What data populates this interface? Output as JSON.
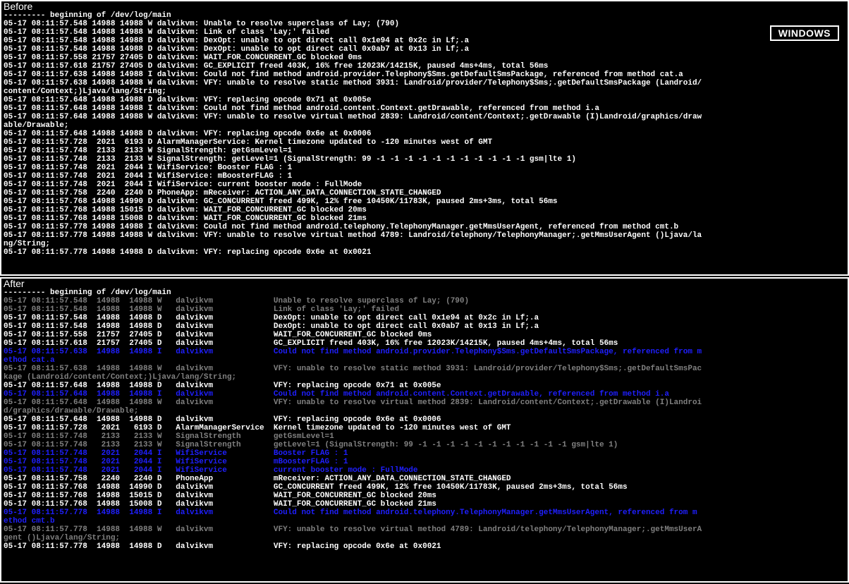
{
  "badge": "WINDOWS",
  "before": {
    "title": "Before",
    "lines": [
      "--------- beginning of /dev/log/main",
      "05-17 08:11:57.548 14988 14988 W dalvikvm: Unable to resolve superclass of Lay; (790)",
      "05-17 08:11:57.548 14988 14988 W dalvikvm: Link of class 'Lay;' failed",
      "05-17 08:11:57.548 14988 14988 D dalvikvm: DexOpt: unable to opt direct call 0x1e94 at 0x2c in Lf;.a",
      "05-17 08:11:57.548 14988 14988 D dalvikvm: DexOpt: unable to opt direct call 0x0ab7 at 0x13 in Lf;.a",
      "05-17 08:11:57.558 21757 27405 D dalvikvm: WAIT_FOR_CONCURRENT_GC blocked 0ms",
      "05-17 08:11:57.618 21757 27405 D dalvikvm: GC_EXPLICIT freed 403K, 16% free 12023K/14215K, paused 4ms+4ms, total 56ms",
      "05-17 08:11:57.638 14988 14988 I dalvikvm: Could not find method android.provider.Telephony$Sms.getDefaultSmsPackage, referenced from method cat.a",
      "05-17 08:11:57.638 14988 14988 W dalvikvm: VFY: unable to resolve static method 3931: Landroid/provider/Telephony$Sms;.getDefaultSmsPackage (Landroid/",
      "content/Context;)Ljava/lang/String;",
      "05-17 08:11:57.648 14988 14988 D dalvikvm: VFY: replacing opcode 0x71 at 0x005e",
      "05-17 08:11:57.648 14988 14988 I dalvikvm: Could not find method android.content.Context.getDrawable, referenced from method i.a",
      "05-17 08:11:57.648 14988 14988 W dalvikvm: VFY: unable to resolve virtual method 2839: Landroid/content/Context;.getDrawable (I)Landroid/graphics/draw",
      "able/Drawable;",
      "05-17 08:11:57.648 14988 14988 D dalvikvm: VFY: replacing opcode 0x6e at 0x0006",
      "05-17 08:11:57.728  2021  6193 D AlarmManagerService: Kernel timezone updated to -120 minutes west of GMT",
      "05-17 08:11:57.748  2133  2133 W SignalStrength: getGsmLevel=1",
      "05-17 08:11:57.748  2133  2133 W SignalStrength: getLevel=1 (SignalStrength: 99 -1 -1 -1 -1 -1 -1 -1 -1 -1 -1 -1 gsm|lte 1)",
      "05-17 08:11:57.748  2021  2044 I WifiService: Booster FLAG : 1",
      "05-17 08:11:57.748  2021  2044 I WifiService: mBoosterFLAG : 1",
      "05-17 08:11:57.748  2021  2044 I WifiService: current booster mode : FullMode",
      "05-17 08:11:57.758  2240  2240 D PhoneApp: mReceiver: ACTION_ANY_DATA_CONNECTION_STATE_CHANGED",
      "05-17 08:11:57.768 14988 14990 D dalvikvm: GC_CONCURRENT freed 499K, 12% free 10450K/11783K, paused 2ms+3ms, total 56ms",
      "05-17 08:11:57.768 14988 15015 D dalvikvm: WAIT_FOR_CONCURRENT_GC blocked 20ms",
      "05-17 08:11:57.768 14988 15008 D dalvikvm: WAIT_FOR_CONCURRENT_GC blocked 21ms",
      "05-17 08:11:57.778 14988 14988 I dalvikvm: Could not find method android.telephony.TelephonyManager.getMmsUserAgent, referenced from method cmt.b",
      "05-17 08:11:57.778 14988 14988 W dalvikvm: VFY: unable to resolve virtual method 4789: Landroid/telephony/TelephonyManager;.getMmsUserAgent ()Ljava/la",
      "ng/String;",
      "05-17 08:11:57.778 14988 14988 D dalvikvm: VFY: replacing opcode 0x6e at 0x0021"
    ]
  },
  "after": {
    "title": "After",
    "lines": [
      {
        "cls": "c-plain",
        "text": "--------- beginning of /dev/log/main"
      },
      {
        "cls": "c-warn",
        "text": "05-17 08:11:57.548  14988  14988 W   dalvikvm             Unable to resolve superclass of Lay; (790)"
      },
      {
        "cls": "c-warn",
        "text": "05-17 08:11:57.548  14988  14988 W   dalvikvm             Link of class 'Lay;' failed"
      },
      {
        "cls": "c-debug",
        "text": "05-17 08:11:57.548  14988  14988 D   dalvikvm             DexOpt: unable to opt direct call 0x1e94 at 0x2c in Lf;.a"
      },
      {
        "cls": "c-debug",
        "text": "05-17 08:11:57.548  14988  14988 D   dalvikvm             DexOpt: unable to opt direct call 0x0ab7 at 0x13 in Lf;.a"
      },
      {
        "cls": "c-debug",
        "text": "05-17 08:11:57.558  21757  27405 D   dalvikvm             WAIT_FOR_CONCURRENT_GC blocked 0ms"
      },
      {
        "cls": "c-debug",
        "text": "05-17 08:11:57.618  21757  27405 D   dalvikvm             GC_EXPLICIT freed 403K, 16% free 12023K/14215K, paused 4ms+4ms, total 56ms"
      },
      {
        "cls": "c-info",
        "text": "05-17 08:11:57.638  14988  14988 I   dalvikvm             Could not find method android.provider.Telephony$Sms.getDefaultSmsPackage, referenced from m"
      },
      {
        "cls": "c-info",
        "text": "ethod cat.a"
      },
      {
        "cls": "c-warn",
        "text": "05-17 08:11:57.638  14988  14988 W   dalvikvm             VFY: unable to resolve static method 3931: Landroid/provider/Telephony$Sms;.getDefaultSmsPac"
      },
      {
        "cls": "c-warn",
        "text": "kage (Landroid/content/Context;)Ljava/lang/String;"
      },
      {
        "cls": "c-debug",
        "text": "05-17 08:11:57.648  14988  14988 D   dalvikvm             VFY: replacing opcode 0x71 at 0x005e"
      },
      {
        "cls": "c-info",
        "text": "05-17 08:11:57.648  14988  14988 I   dalvikvm             Could not find method android.content.Context.getDrawable, referenced from method i.a"
      },
      {
        "cls": "c-warn",
        "text": "05-17 08:11:57.648  14988  14988 W   dalvikvm             VFY: unable to resolve virtual method 2839: Landroid/content/Context;.getDrawable (I)Landroi"
      },
      {
        "cls": "c-warn",
        "text": "d/graphics/drawable/Drawable;"
      },
      {
        "cls": "c-debug",
        "text": "05-17 08:11:57.648  14988  14988 D   dalvikvm             VFY: replacing opcode 0x6e at 0x0006"
      },
      {
        "cls": "c-debug",
        "text": "05-17 08:11:57.728   2021   6193 D   AlarmManagerService  Kernel timezone updated to -120 minutes west of GMT"
      },
      {
        "cls": "c-warn",
        "text": "05-17 08:11:57.748   2133   2133 W   SignalStrength       getGsmLevel=1"
      },
      {
        "cls": "c-warn",
        "text": "05-17 08:11:57.748   2133   2133 W   SignalStrength       getLevel=1 (SignalStrength: 99 -1 -1 -1 -1 -1 -1 -1 -1 -1 -1 -1 gsm|lte 1)"
      },
      {
        "cls": "c-info",
        "text": "05-17 08:11:57.748   2021   2044 I   WifiService          Booster FLAG : 1"
      },
      {
        "cls": "c-info",
        "text": "05-17 08:11:57.748   2021   2044 I   WifiService          mBoosterFLAG : 1"
      },
      {
        "cls": "c-info",
        "text": "05-17 08:11:57.748   2021   2044 I   WifiService          current booster mode : FullMode"
      },
      {
        "cls": "c-debug",
        "text": "05-17 08:11:57.758   2240   2240 D   PhoneApp             mReceiver: ACTION_ANY_DATA_CONNECTION_STATE_CHANGED"
      },
      {
        "cls": "c-debug",
        "text": "05-17 08:11:57.768  14988  14990 D   dalvikvm             GC_CONCURRENT freed 499K, 12% free 10450K/11783K, paused 2ms+3ms, total 56ms"
      },
      {
        "cls": "c-debug",
        "text": "05-17 08:11:57.768  14988  15015 D   dalvikvm             WAIT_FOR_CONCURRENT_GC blocked 20ms"
      },
      {
        "cls": "c-debug",
        "text": "05-17 08:11:57.768  14988  15008 D   dalvikvm             WAIT_FOR_CONCURRENT_GC blocked 21ms"
      },
      {
        "cls": "c-info",
        "text": "05-17 08:11:57.778  14988  14988 I   dalvikvm             Could not find method android.telephony.TelephonyManager.getMmsUserAgent, referenced from m"
      },
      {
        "cls": "c-info",
        "text": "ethod cmt.b"
      },
      {
        "cls": "c-warn",
        "text": "05-17 08:11:57.778  14988  14988 W   dalvikvm             VFY: unable to resolve virtual method 4789: Landroid/telephony/TelephonyManager;.getMmsUserA"
      },
      {
        "cls": "c-warn",
        "text": "gent ()Ljava/lang/String;"
      },
      {
        "cls": "c-debug",
        "text": "05-17 08:11:57.778  14988  14988 D   dalvikvm             VFY: replacing opcode 0x6e at 0x0021"
      }
    ]
  }
}
